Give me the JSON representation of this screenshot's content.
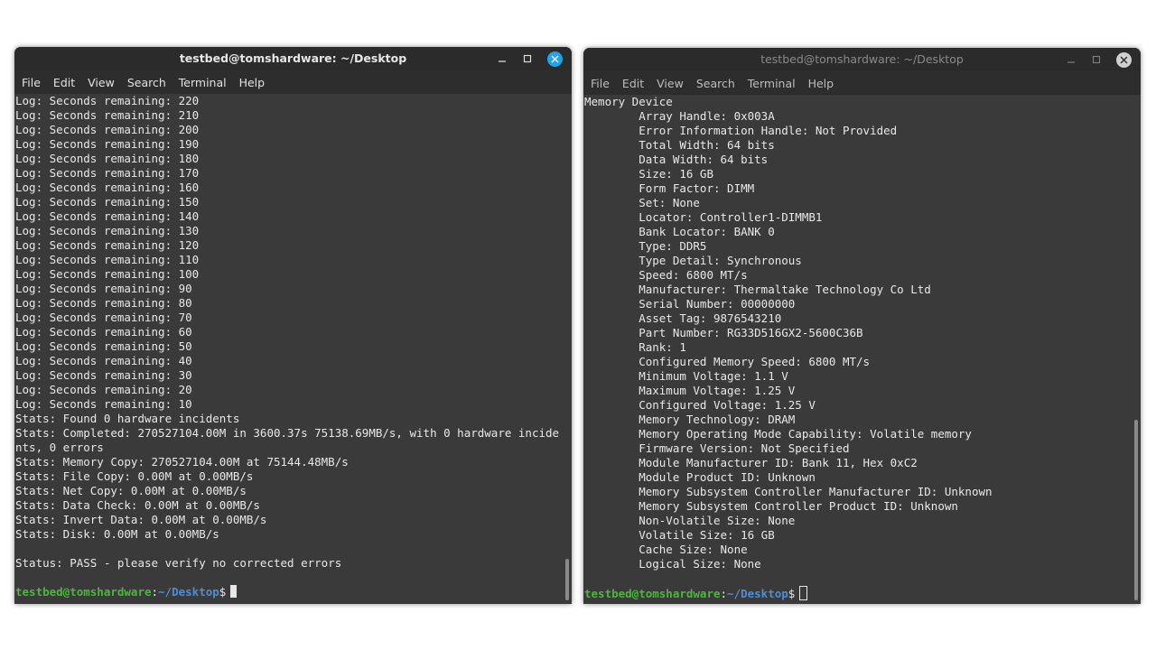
{
  "left_window": {
    "title": "testbed@tomshardware: ~/Desktop",
    "menu": [
      "File",
      "Edit",
      "View",
      "Search",
      "Terminal",
      "Help"
    ],
    "lines": [
      "Log: Seconds remaining: 220",
      "Log: Seconds remaining: 210",
      "Log: Seconds remaining: 200",
      "Log: Seconds remaining: 190",
      "Log: Seconds remaining: 180",
      "Log: Seconds remaining: 170",
      "Log: Seconds remaining: 160",
      "Log: Seconds remaining: 150",
      "Log: Seconds remaining: 140",
      "Log: Seconds remaining: 130",
      "Log: Seconds remaining: 120",
      "Log: Seconds remaining: 110",
      "Log: Seconds remaining: 100",
      "Log: Seconds remaining: 90",
      "Log: Seconds remaining: 80",
      "Log: Seconds remaining: 70",
      "Log: Seconds remaining: 60",
      "Log: Seconds remaining: 50",
      "Log: Seconds remaining: 40",
      "Log: Seconds remaining: 30",
      "Log: Seconds remaining: 20",
      "Log: Seconds remaining: 10",
      "Stats: Found 0 hardware incidents",
      "Stats: Completed: 270527104.00M in 3600.37s 75138.69MB/s, with 0 hardware incide",
      "nts, 0 errors",
      "Stats: Memory Copy: 270527104.00M at 75144.48MB/s",
      "Stats: File Copy: 0.00M at 0.00MB/s",
      "Stats: Net Copy: 0.00M at 0.00MB/s",
      "Stats: Data Check: 0.00M at 0.00MB/s",
      "Stats: Invert Data: 0.00M at 0.00MB/s",
      "Stats: Disk: 0.00M at 0.00MB/s",
      "",
      "Status: PASS - please verify no corrected errors",
      ""
    ],
    "prompt": {
      "user": "testbed@tomshardware",
      "sep": ":",
      "path": "~/Desktop",
      "symbol": "$"
    }
  },
  "right_window": {
    "title": "testbed@tomshardware: ~/Desktop",
    "menu": [
      "File",
      "Edit",
      "View",
      "Search",
      "Terminal",
      "Help"
    ],
    "lines": [
      "Memory Device",
      "        Array Handle: 0x003A",
      "        Error Information Handle: Not Provided",
      "        Total Width: 64 bits",
      "        Data Width: 64 bits",
      "        Size: 16 GB",
      "        Form Factor: DIMM",
      "        Set: None",
      "        Locator: Controller1-DIMMB1",
      "        Bank Locator: BANK 0",
      "        Type: DDR5",
      "        Type Detail: Synchronous",
      "        Speed: 6800 MT/s",
      "        Manufacturer: Thermaltake Technology Co Ltd",
      "        Serial Number: 00000000",
      "        Asset Tag: 9876543210",
      "        Part Number: RG33D516GX2-5600C36B",
      "        Rank: 1",
      "        Configured Memory Speed: 6800 MT/s",
      "        Minimum Voltage: 1.1 V",
      "        Maximum Voltage: 1.25 V",
      "        Configured Voltage: 1.25 V",
      "        Memory Technology: DRAM",
      "        Memory Operating Mode Capability: Volatile memory",
      "        Firmware Version: Not Specified",
      "        Module Manufacturer ID: Bank 11, Hex 0xC2",
      "        Module Product ID: Unknown",
      "        Memory Subsystem Controller Manufacturer ID: Unknown",
      "        Memory Subsystem Controller Product ID: Unknown",
      "        Non-Volatile Size: None",
      "        Volatile Size: 16 GB",
      "        Cache Size: None",
      "        Logical Size: None",
      ""
    ],
    "prompt": {
      "user": "testbed@tomshardware",
      "sep": ":",
      "path": "~/Desktop",
      "symbol": "$"
    }
  },
  "icons": {
    "minimize": "minimize-icon",
    "maximize": "maximize-icon",
    "close": "close-icon"
  },
  "colors": {
    "terminal_bg": "#3a3a3a",
    "prompt_user": "#4eb53f",
    "prompt_path": "#4c8fd6",
    "close_active": "#1fa4e8"
  }
}
